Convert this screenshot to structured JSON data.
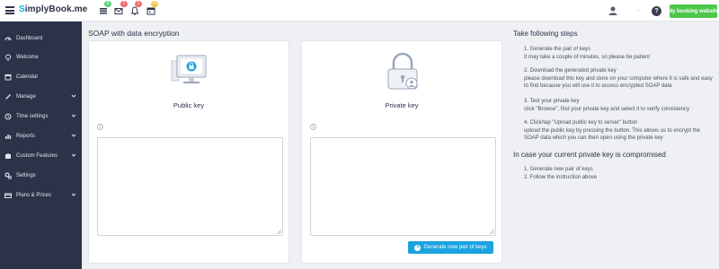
{
  "header": {
    "logo_prefix": "S",
    "logo_text": "implyBook",
    "logo_suffix": ".me",
    "badges": {
      "tasks": "5",
      "messages": "1",
      "notifications": "1",
      "calendar": "25"
    },
    "help_label": "?",
    "booking_button": "My booking website",
    "user_caret": "-"
  },
  "colors": {
    "sidebar_bg": "#2c3348",
    "accent_blue": "#1aa3e0",
    "booking_green": "#4cc74a",
    "badge_green": "#5cd37a",
    "badge_red": "#f26b6b",
    "badge_yellow": "#f4c542"
  },
  "sidebar": {
    "items": [
      {
        "label": "Dashboard",
        "icon": "dashboard-icon"
      },
      {
        "label": "Welcome",
        "icon": "welcome-icon"
      },
      {
        "label": "Calendar",
        "icon": "calendar-icon"
      },
      {
        "label": "Manage",
        "icon": "manage-icon",
        "expandable": true
      },
      {
        "label": "Time settings",
        "icon": "clock-icon",
        "expandable": true
      },
      {
        "label": "Reports",
        "icon": "reports-icon",
        "expandable": true
      },
      {
        "label": "Custom Features",
        "icon": "puzzle-icon",
        "expandable": true
      },
      {
        "label": "Settings",
        "icon": "settings-icon"
      },
      {
        "label": "Plans & Prices",
        "icon": "plans-icon",
        "expandable": true
      }
    ]
  },
  "main": {
    "title": "SOAP with data encryption",
    "public_card": {
      "title": "Public key",
      "value": ""
    },
    "private_card": {
      "title": "Private key",
      "value": ""
    },
    "generate_button": "Generate new pair of keys",
    "generate_icon": "+"
  },
  "steps": {
    "title": "Take following steps",
    "list": [
      [
        "1. Generate the pair of keys",
        "It may take a couple of minutes, so please be patient"
      ],
      [
        "2. Download the generated private key",
        "please download this key and store on your computer where it is safe and easy to find because you will use it to access encrypted SOAP data"
      ],
      [
        "3. Test your private key",
        "click \"Browse\", find your private key and select it to verify consistency"
      ],
      [
        "4. Click/tap \"Upload public key to server\" button",
        "upload the public key by pressing the button. This allows us to encrypt the SOAP data which you can then open using the private key"
      ]
    ],
    "compromised_title": "In case your current private key is compromised",
    "compromised_list": [
      "1. Generate new pair of keys",
      "2. Follow the instruction above"
    ]
  }
}
